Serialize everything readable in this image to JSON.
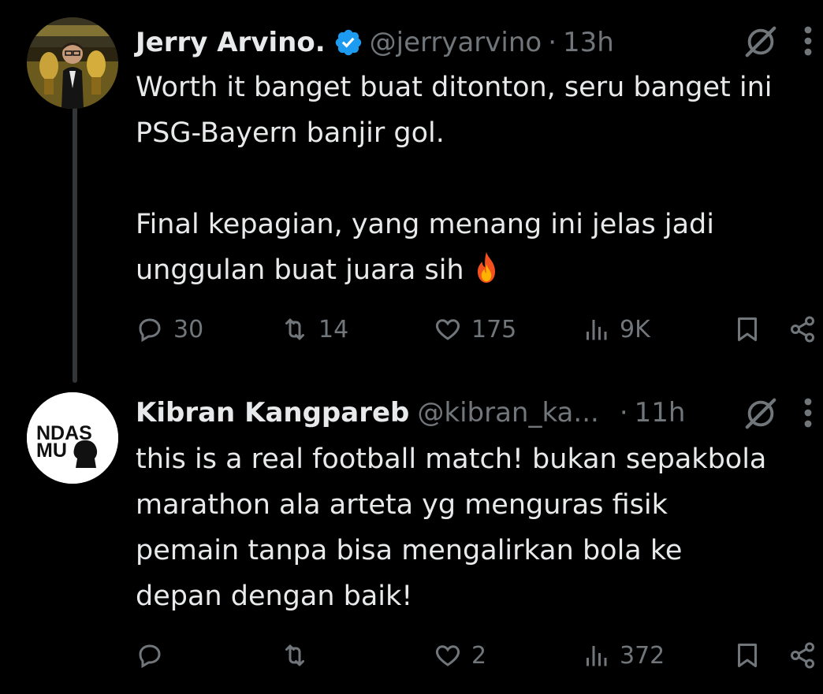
{
  "tweets": [
    {
      "name": "Jerry Arvino.",
      "verified": true,
      "handle": "@jerryarvino",
      "dot": "·",
      "time": "13h",
      "lines": [
        "Worth it banget buat ditonton, seru banget ini",
        "PSG-Bayern banjir gol.",
        "Final kepagian, yang menang ini jelas jadi",
        "unggulan buat juara sih"
      ],
      "emoji": "fire-emoji",
      "actions": {
        "replies": "30",
        "reposts": "14",
        "likes": "175",
        "views": "9K"
      }
    },
    {
      "name": "Kibran Kangpareb",
      "verified": false,
      "handle": "@kibran_ka...",
      "dot": "·",
      "time": "11h",
      "avatar_text": [
        "NDAS",
        "MU"
      ],
      "lines": [
        "this is a real football match! bukan sepakbola",
        "marathon ala arteta yg menguras fisik",
        "pemain tanpa bisa mengalirkan bola ke",
        "depan dengan baik!"
      ],
      "actions": {
        "replies": "",
        "reposts": "",
        "likes": "2",
        "views": "372"
      }
    }
  ],
  "icons": {
    "verified": "verified-badge-icon",
    "grok": "grok-icon",
    "more": "more-icon",
    "reply": "reply-icon",
    "repost": "repost-icon",
    "like": "heart-icon",
    "views": "views-icon",
    "bookmark": "bookmark-icon",
    "share": "share-icon"
  },
  "colors": {
    "background": "#000000",
    "text": "#e7e9ea",
    "muted": "#71767b",
    "verified": "#1d9bf0",
    "thread_line": "#333639"
  }
}
